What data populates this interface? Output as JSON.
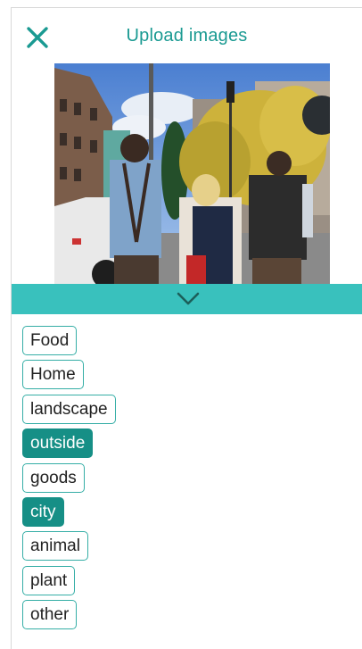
{
  "header": {
    "title": "Upload images",
    "close_icon": "close-icon"
  },
  "photo": {
    "description_icon": "street-photo"
  },
  "collapse": {
    "icon": "chevron-down-icon"
  },
  "tags": [
    {
      "label": "Food",
      "selected": false
    },
    {
      "label": "Home",
      "selected": false
    },
    {
      "label": "landscape",
      "selected": false
    },
    {
      "label": "outside",
      "selected": true
    },
    {
      "label": "goods",
      "selected": false
    },
    {
      "label": "city",
      "selected": true
    },
    {
      "label": "animal",
      "selected": false
    },
    {
      "label": "plant",
      "selected": false
    },
    {
      "label": "other",
      "selected": false
    }
  ],
  "colors": {
    "accent": "#1a9a92",
    "bar": "#39c1bd",
    "selected": "#168f86"
  }
}
